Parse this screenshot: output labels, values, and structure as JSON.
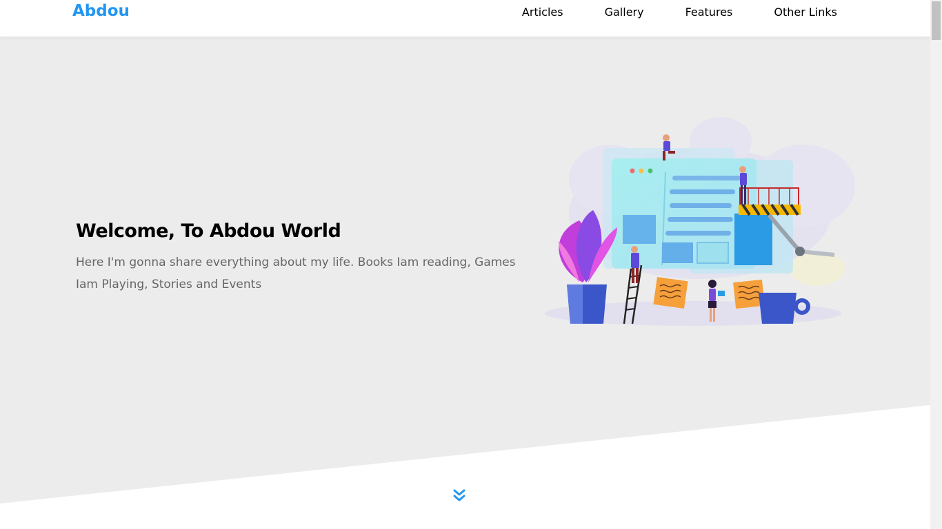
{
  "header": {
    "logo": "Abdou",
    "nav": [
      {
        "label": "Articles"
      },
      {
        "label": "Gallery"
      },
      {
        "label": "Features"
      },
      {
        "label": "Other Links"
      }
    ]
  },
  "hero": {
    "title": "Welcome, To Abdou World",
    "description": "Here I'm gonna share everything about my life. Books Iam reading, Games Iam Playing, Stories and Events",
    "illustration_icon": "web-development-illustration",
    "scroll_icon": "double-chevron-down-icon"
  },
  "colors": {
    "accent": "#2196f3",
    "hero_background": "#ececec",
    "heading": "#000000",
    "text": "#666666"
  }
}
